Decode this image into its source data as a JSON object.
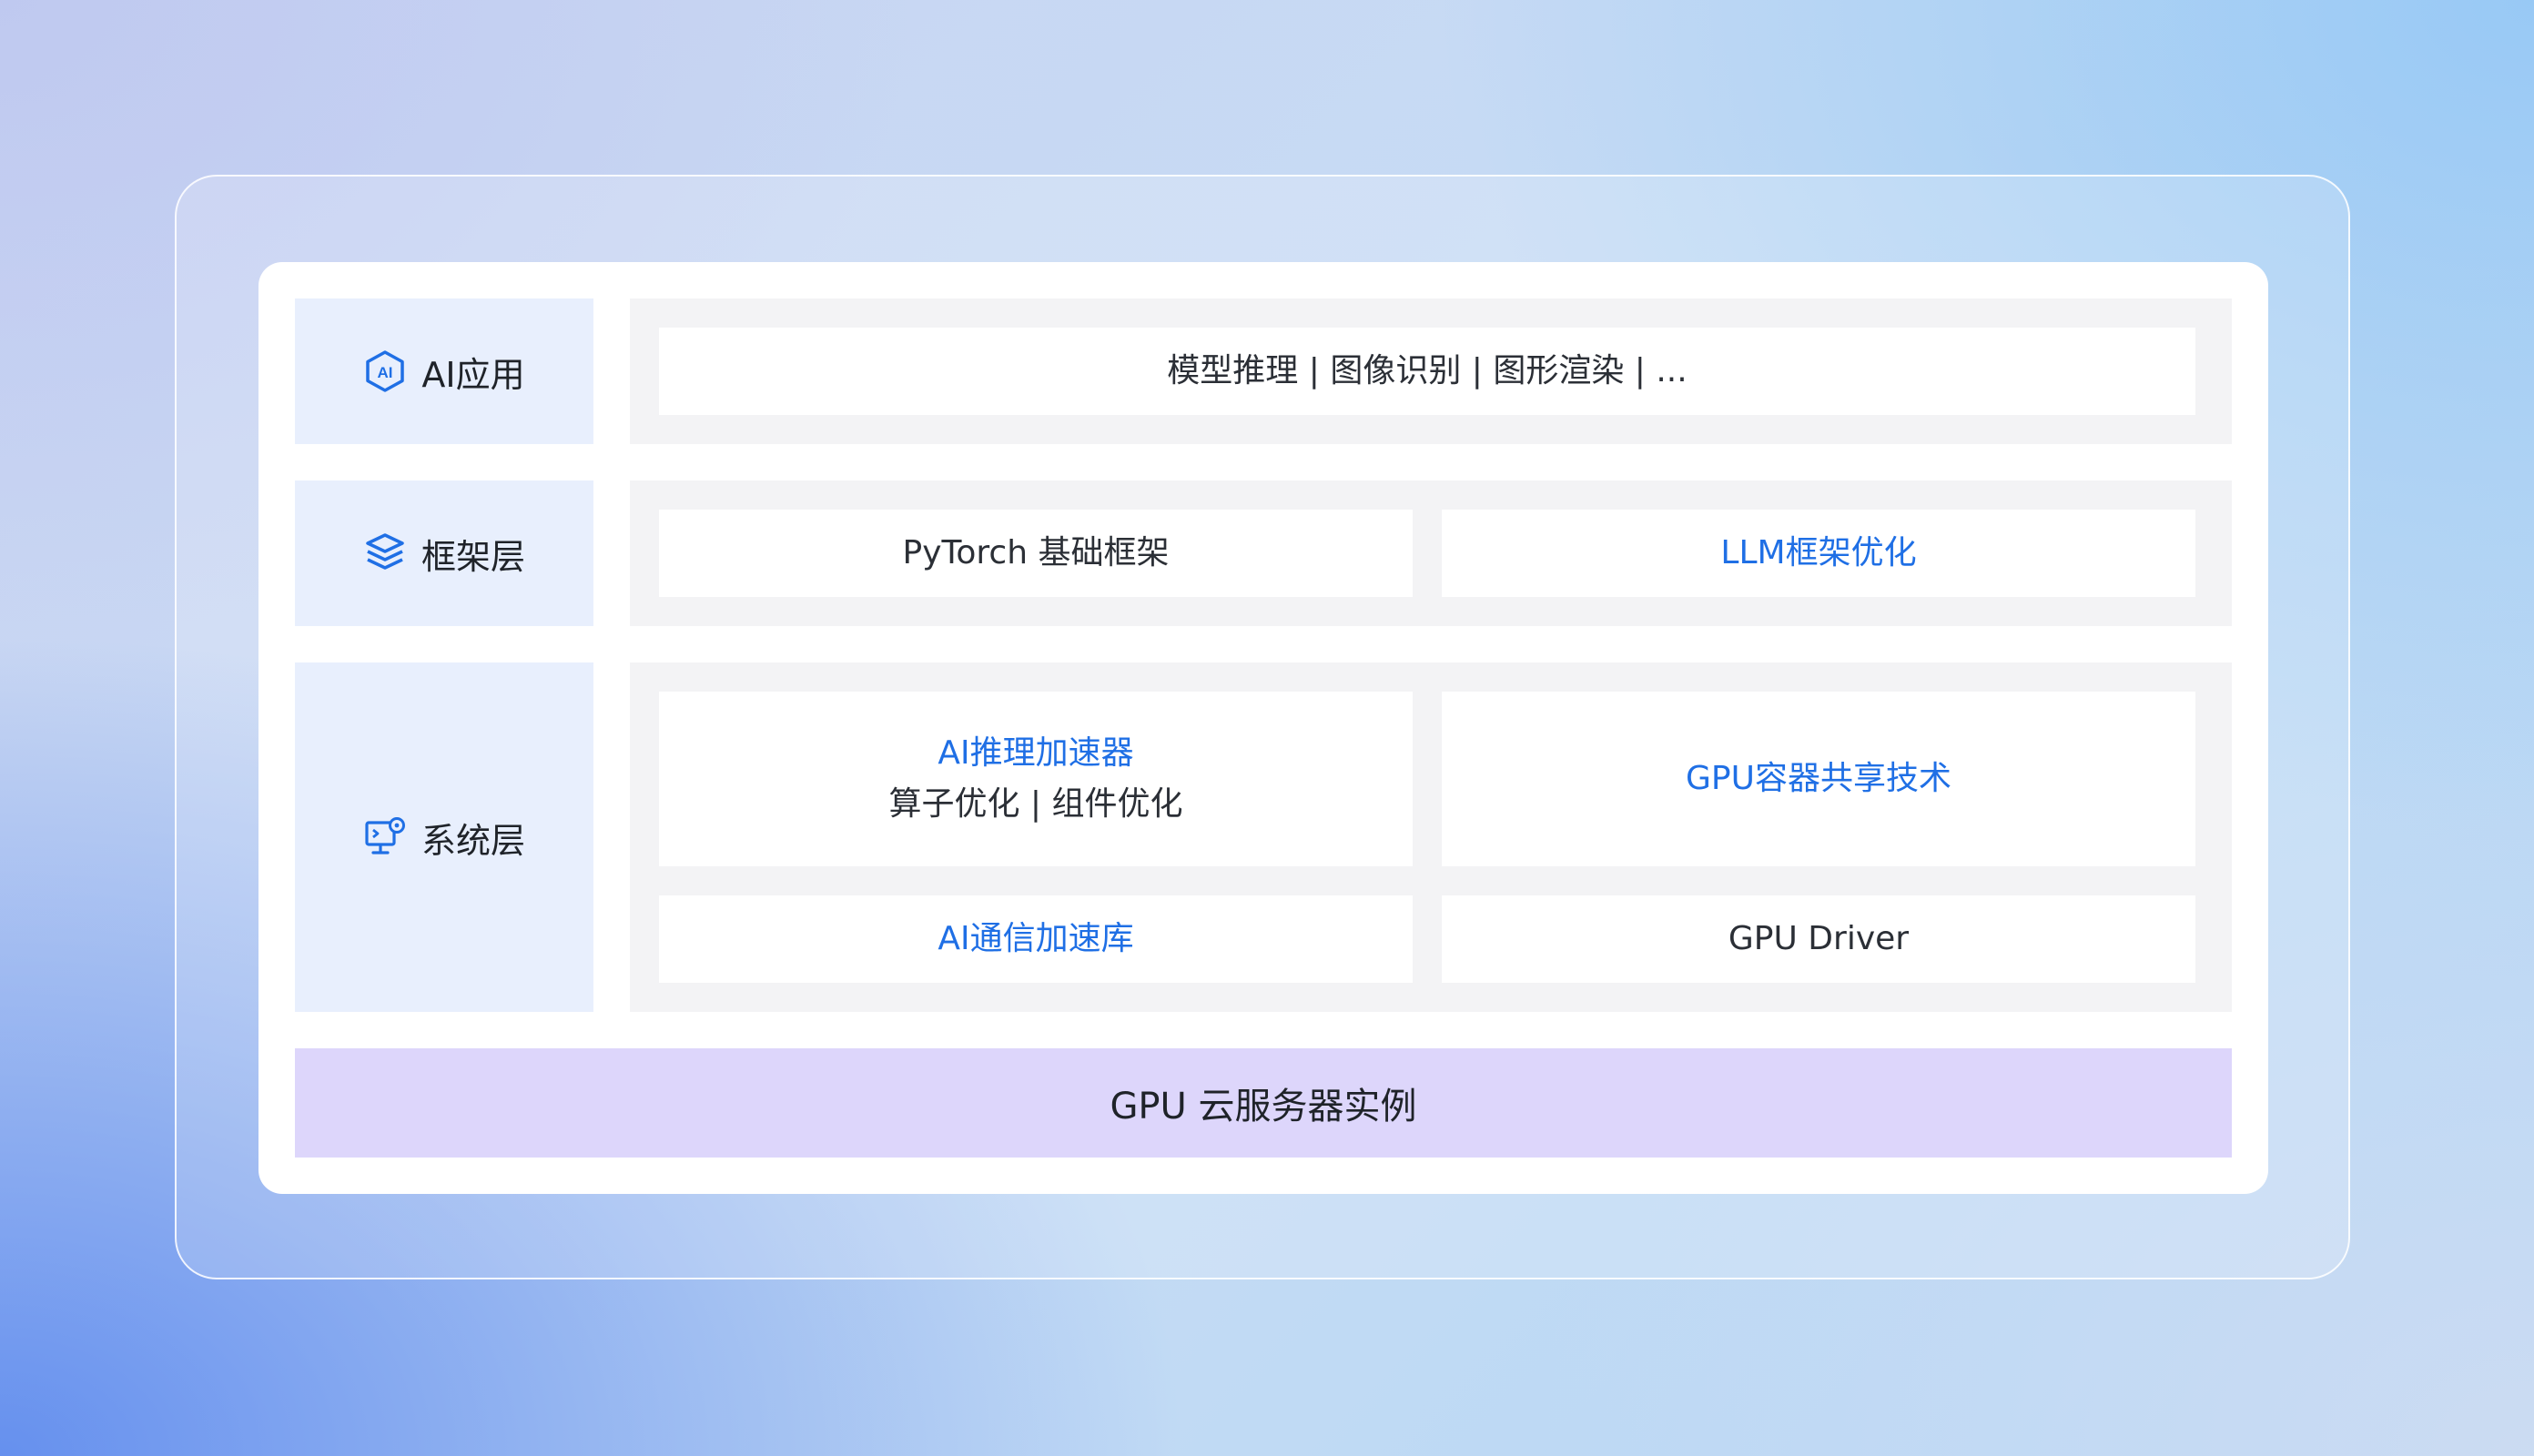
{
  "layers": {
    "app": {
      "label": "AI应用",
      "icon": "ai-hexagon-icon",
      "content": "模型推理 | 图像识别 | 图形渲染 | ..."
    },
    "framework": {
      "label": "框架层",
      "icon": "layers-stack-icon",
      "items": [
        "PyTorch 基础框架",
        "LLM框架优化"
      ]
    },
    "system": {
      "label": "系统层",
      "icon": "monitor-settings-icon",
      "inference_title": "AI推理加速器",
      "inference_sub": "算子优化 | 组件优化",
      "gpu_sharing": "GPU容器共享技术",
      "comm_lib": "AI通信加速库",
      "driver": "GPU Driver"
    }
  },
  "base": {
    "label": "GPU 云服务器实例"
  },
  "colors": {
    "accent_blue": "#1f6fe5",
    "label_bg": "#e8effd",
    "group_bg": "#f3f3f5",
    "base_bg": "#ddd6fb"
  }
}
